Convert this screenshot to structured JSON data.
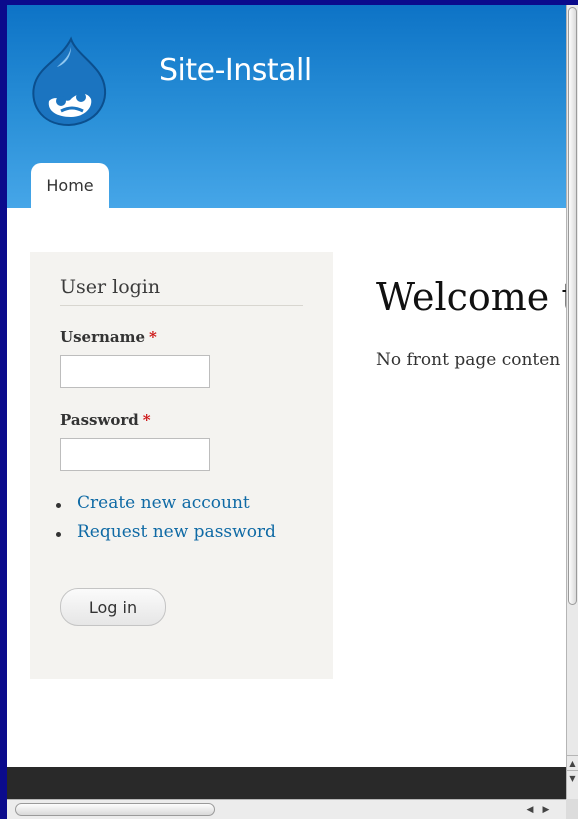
{
  "header": {
    "site_name": "Site-Install",
    "logo_icon": "drupal-drop-logo"
  },
  "nav": {
    "tabs": [
      {
        "label": "Home",
        "active": true
      }
    ]
  },
  "login_block": {
    "title": "User login",
    "username_label": "Username",
    "password_label": "Password",
    "required_marker": "*",
    "username_value": "",
    "password_value": "",
    "links": [
      "Create new account",
      "Request new password"
    ],
    "submit_label": "Log in"
  },
  "main": {
    "title": "Welcome t",
    "text": "No front page conten"
  },
  "colors": {
    "header_top": "#0d73c6",
    "header_bottom": "#46a6e8",
    "link": "#0f6aa5",
    "required": "#cc1111",
    "sidebar_bg": "#f4f3f0",
    "footer_bg": "#292929",
    "desktop_bg": "#0b0b8c"
  }
}
